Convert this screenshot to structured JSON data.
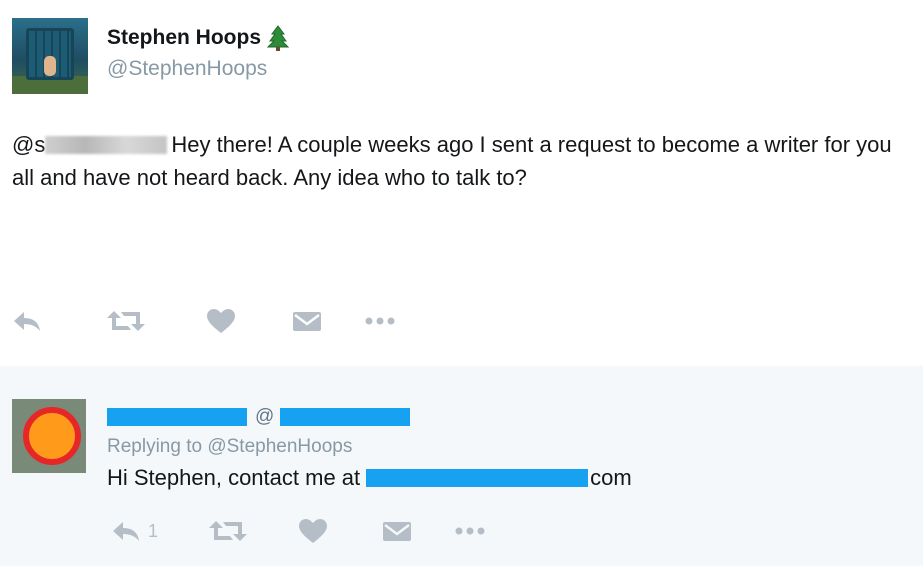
{
  "tweet": {
    "display_name": "Stephen Hoops",
    "name_icon": "tree-icon",
    "handle": "@StephenHoops",
    "mention_prefix": "@s",
    "text": "Hey there! A couple weeks ago I sent a request to become a writer for you all and have not heard back. Any idea who to talk to?",
    "actions": [
      "reply-icon",
      "retweet-icon",
      "like-icon",
      "dm-icon",
      "more-icon"
    ]
  },
  "reply": {
    "at_sign": "@",
    "replying_to": "Replying to @StephenHoops",
    "text_prefix": "Hi Stephen, contact me at",
    "text_suffix": "com",
    "reply_count": "1",
    "actions": [
      "reply-icon",
      "retweet-icon",
      "like-icon",
      "dm-icon",
      "more-icon"
    ]
  },
  "colors": {
    "icon_gray": "#b5bec6",
    "reply_background": "#f5f8fa",
    "redaction_blue": "#16a1f1",
    "handle_gray": "#8899a6"
  }
}
